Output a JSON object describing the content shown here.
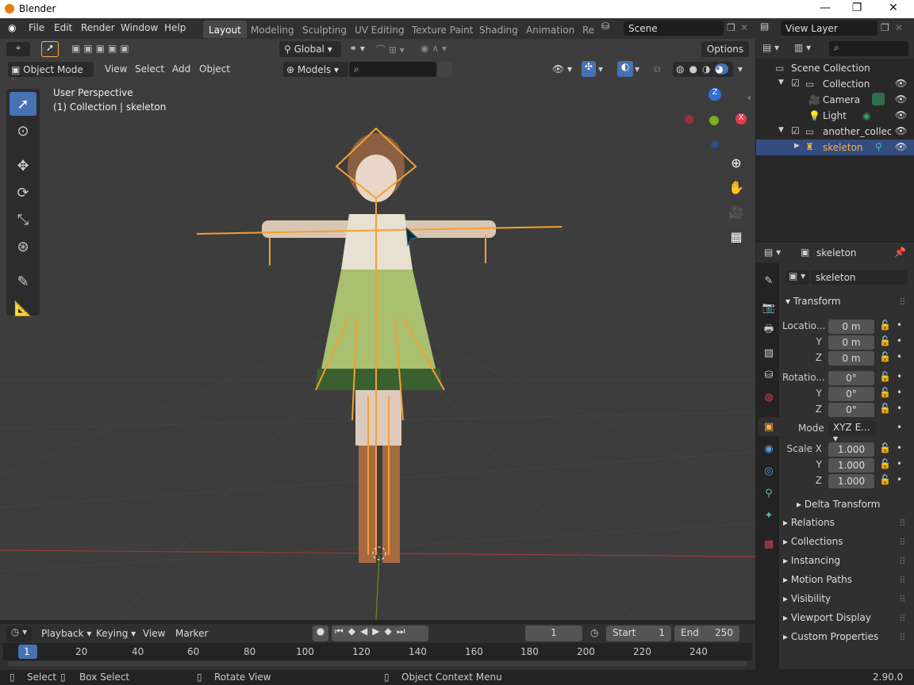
{
  "window": {
    "title": "Blender",
    "minimize": "—",
    "maximize": "❐",
    "close": "✕"
  },
  "menu": {
    "file": "File",
    "edit": "Edit",
    "render": "Render",
    "window": "Window",
    "help": "Help"
  },
  "workspaces": [
    "Layout",
    "Modeling",
    "Sculpting",
    "UV Editing",
    "Texture Paint",
    "Shading",
    "Animation",
    "Re"
  ],
  "scene": {
    "label": "Scene",
    "view_layer": "View Layer"
  },
  "viewport_header": {
    "mode": "Object Mode",
    "view": "View",
    "select": "Select",
    "add": "Add",
    "object": "Object",
    "orientation": "Global",
    "options": "Options",
    "models": "Models"
  },
  "viewport": {
    "perspective": "User Perspective",
    "collection_info": "(1) Collection | skeleton",
    "gizmo_z": "Z"
  },
  "outliner": {
    "rows": [
      {
        "label": "Scene Collection"
      },
      {
        "label": "Collection"
      },
      {
        "label": "Camera"
      },
      {
        "label": "Light"
      },
      {
        "label": "another_collecti"
      },
      {
        "label": "skeleton"
      }
    ]
  },
  "properties": {
    "object_name": "skeleton",
    "data_name": "skeleton",
    "transform_header": "Transform",
    "location_label": "Locatio...",
    "rotation_label": "Rotatio...",
    "scale_label": "Scale X",
    "y": "Y",
    "z": "Z",
    "loc": [
      "0 m",
      "0 m",
      "0 m"
    ],
    "rot": [
      "0°",
      "0°",
      "0°"
    ],
    "mode_label": "Mode",
    "mode_value": "XYZ E...",
    "scale": [
      "1.000",
      "1.000",
      "1.000"
    ],
    "delta": "Delta Transform",
    "panels": [
      "Relations",
      "Collections",
      "Instancing",
      "Motion Paths",
      "Visibility",
      "Viewport Display",
      "Custom Properties"
    ]
  },
  "timeline": {
    "playback": "Playback",
    "keying": "Keying",
    "view": "View",
    "marker": "Marker",
    "current_frame": "1",
    "start_label": "Start",
    "start_value": "1",
    "end_label": "End",
    "end_value": "250",
    "ticks": [
      "1",
      "20",
      "40",
      "60",
      "80",
      "100",
      "120",
      "140",
      "160",
      "180",
      "200",
      "220",
      "240"
    ]
  },
  "status": {
    "select": "Select",
    "box_select": "Box Select",
    "rotate_view": "Rotate View",
    "context_menu": "Object Context Menu",
    "version": "2.90.0"
  },
  "colors": {
    "accent": "#4772b3",
    "bone": "#f5a030",
    "selection": "#ffae40"
  }
}
